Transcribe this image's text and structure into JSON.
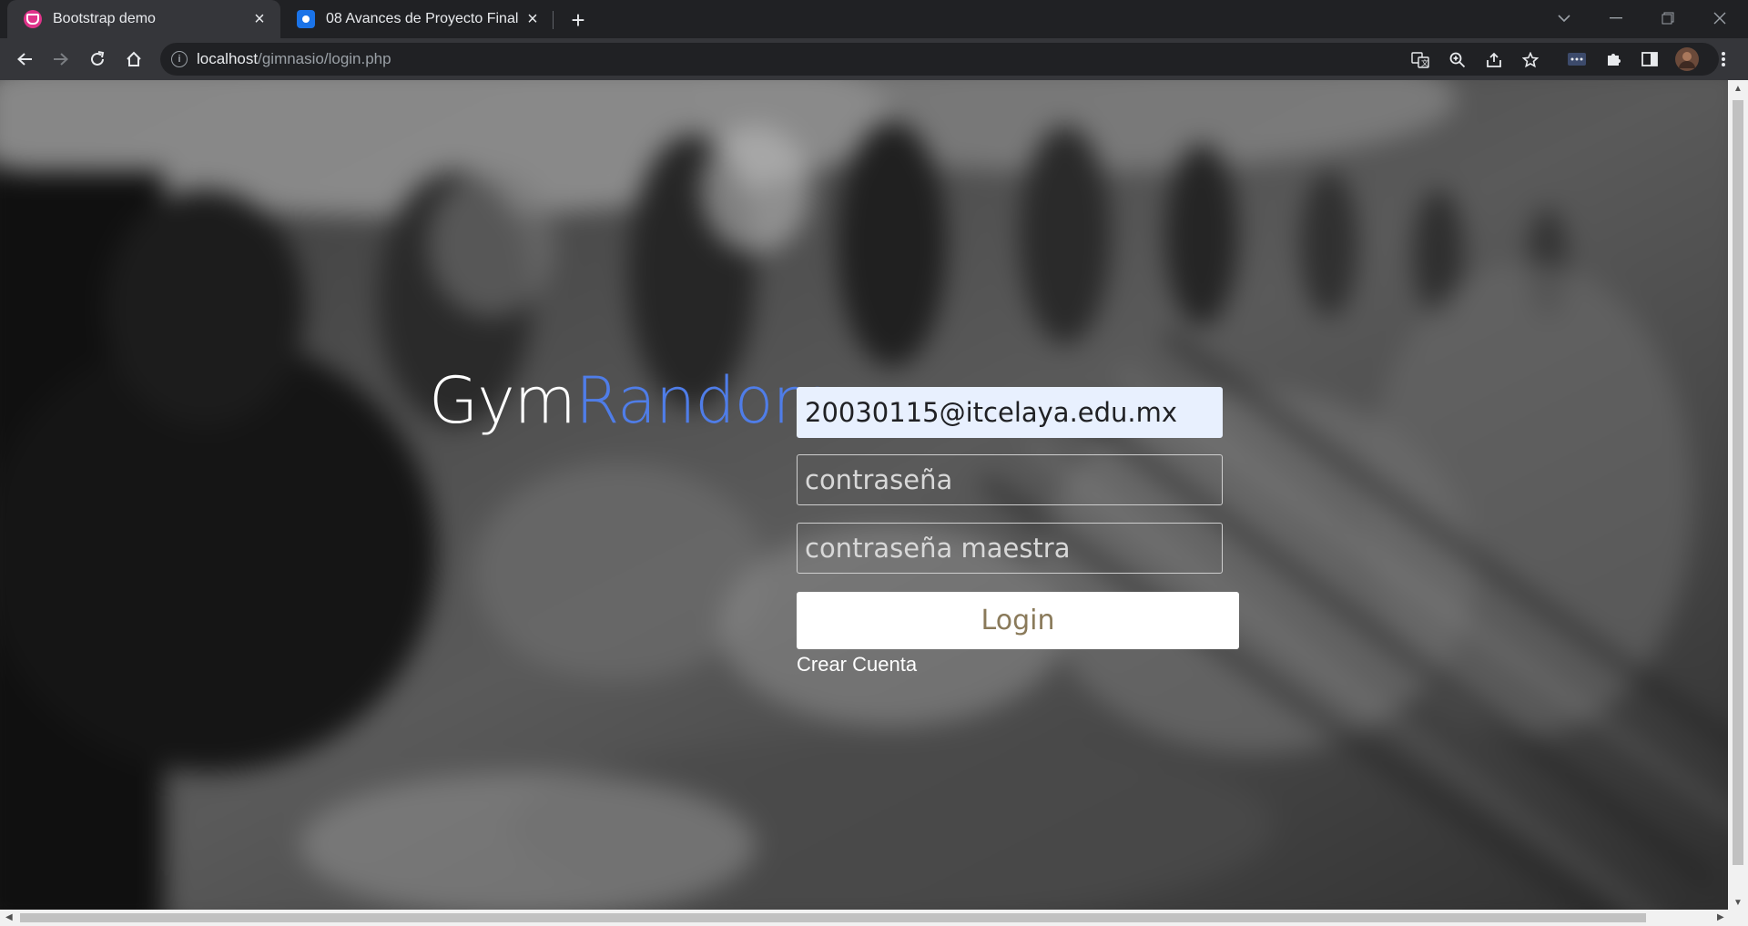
{
  "browser": {
    "tabs": [
      {
        "title": "Bootstrap demo",
        "active": true,
        "favicon": "bootstrap-icon"
      },
      {
        "title": "08 Avances de Proyecto Final",
        "active": false,
        "favicon": "classroom-icon"
      }
    ],
    "url_host": "localhost",
    "url_path": "/gimnasio/login.php"
  },
  "page": {
    "logo_part1": "Gym",
    "logo_part2": "Random",
    "email_value": "20030115@itcelaya.edu.mx",
    "password_placeholder": "contraseña",
    "master_password_placeholder": "contraseña maestra",
    "login_label": "Login",
    "create_account_label": "Crear Cuenta"
  },
  "colors": {
    "accent_blue": "#4f7de8",
    "login_text": "#8a7a5a",
    "autofill_bg": "#e8f0fe"
  }
}
